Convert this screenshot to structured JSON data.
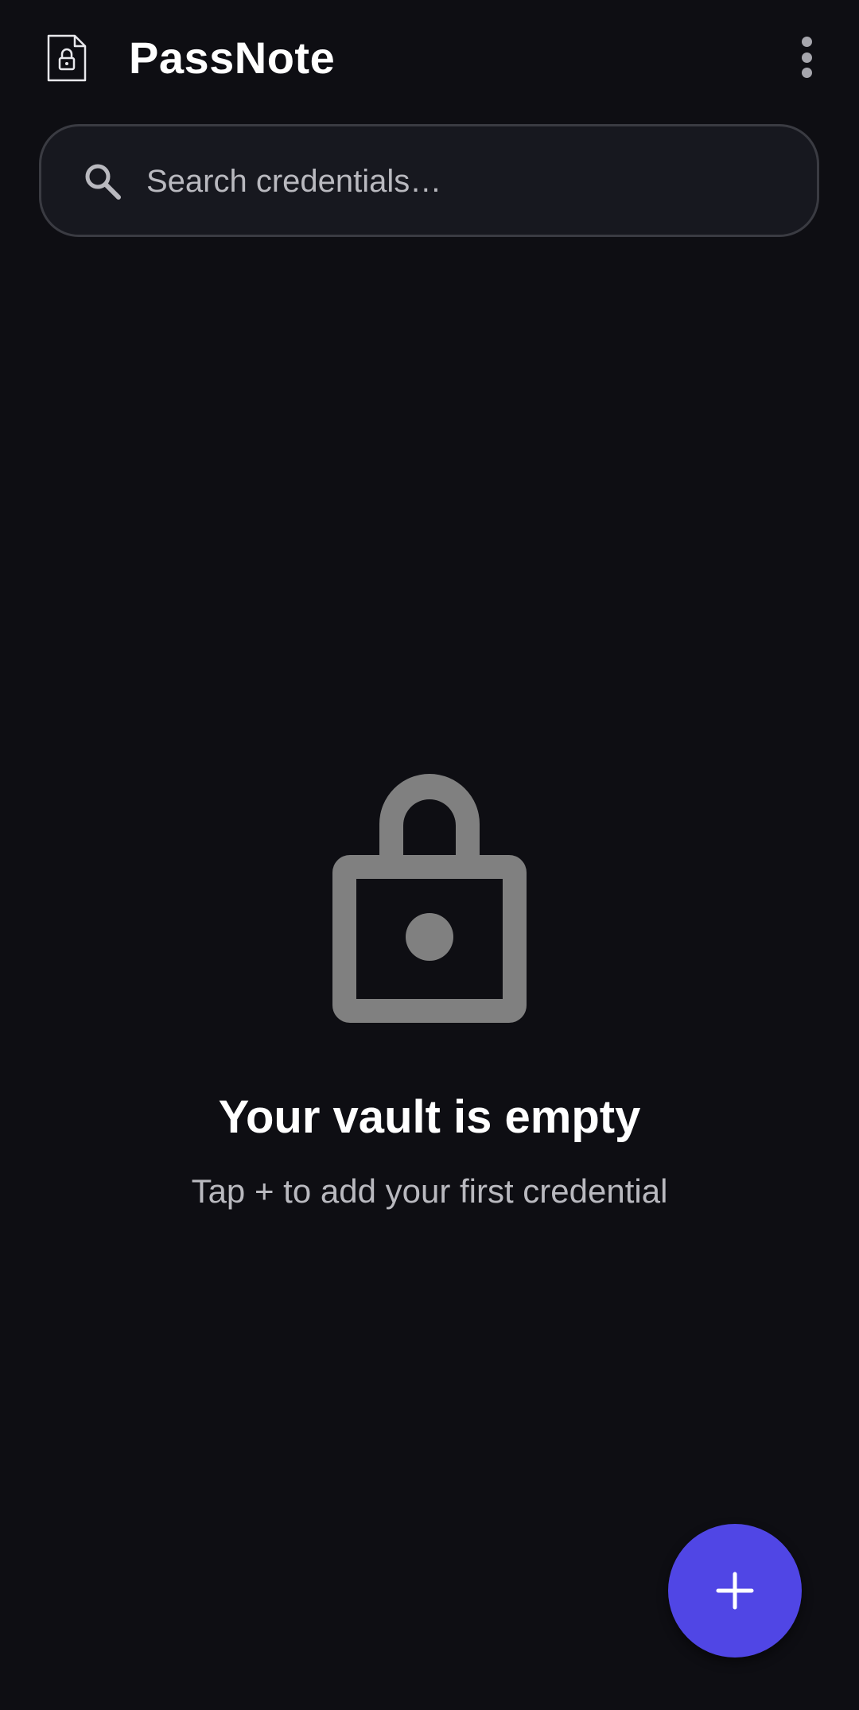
{
  "app": {
    "title": "PassNote",
    "logo_icon": "locked-document-icon",
    "menu_icon": "more-vert-icon"
  },
  "search": {
    "placeholder": "Search credentials…",
    "value": "",
    "icon": "search-icon"
  },
  "empty_state": {
    "icon": "lock-icon",
    "title": "Your vault is empty",
    "subtitle": "Tap + to add your first credential"
  },
  "fab": {
    "icon": "plus-icon",
    "color": "#5046e5"
  },
  "colors": {
    "background": "#0e0e13",
    "search_background": "#17181f",
    "accent": "#5046e5",
    "muted_text": "#b9b9bf",
    "illustration": "#808080"
  }
}
